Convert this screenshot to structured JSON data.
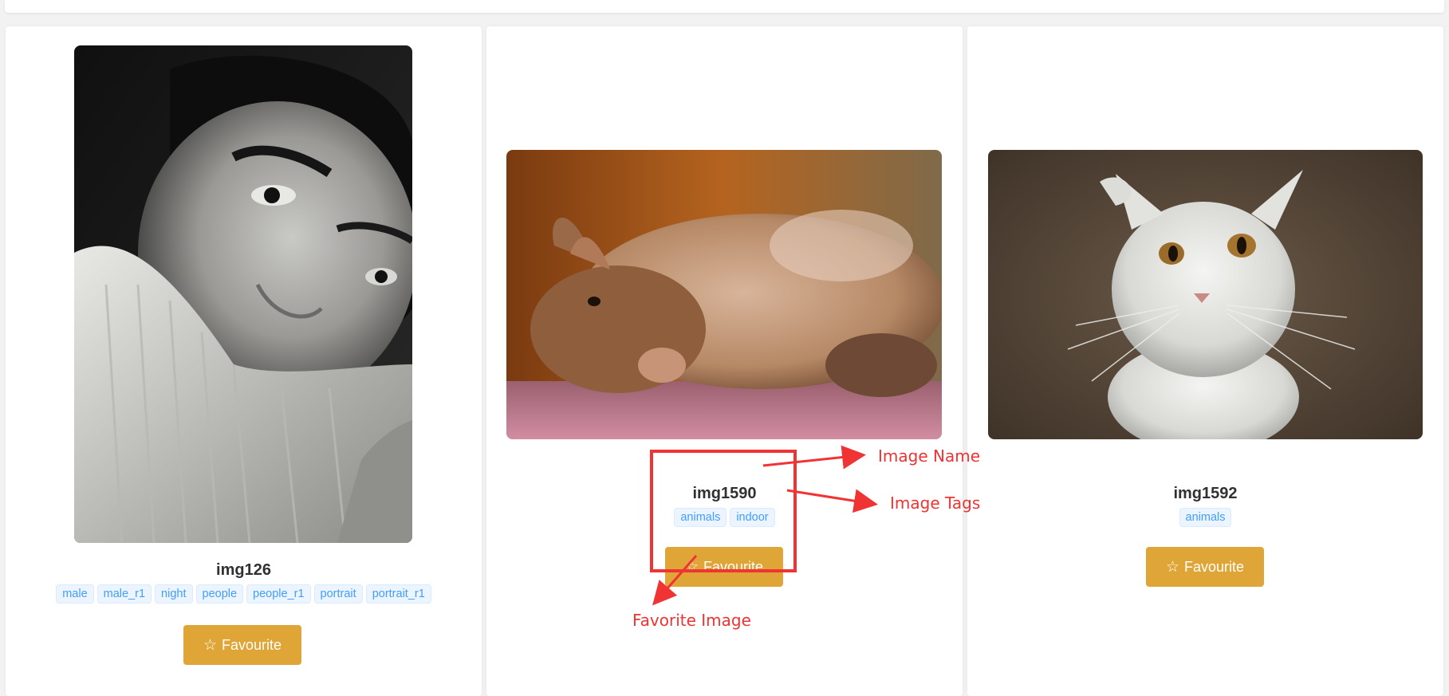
{
  "cards": [
    {
      "name": "img126",
      "tags": [
        "male",
        "male_r1",
        "night",
        "people",
        "people_r1",
        "portrait",
        "portrait_r1"
      ],
      "button_label": "Favourite",
      "image_subject": "portrait of a young man wrapped in a white knit sweater"
    },
    {
      "name": "img1590",
      "tags": [
        "animals",
        "indoor"
      ],
      "button_label": "Favourite",
      "image_subject": "brown rabbit lying on a pink carpet"
    },
    {
      "name": "img1592",
      "tags": [
        "animals"
      ],
      "button_label": "Favourite",
      "image_subject": "white long-haired cat looking up"
    }
  ],
  "annotations": {
    "image_name": "Image Name",
    "image_tags": "Image Tags",
    "favorite_image": "Favorite Image",
    "color": "#f03333"
  },
  "colors": {
    "button": "#e0a537",
    "tag_text": "#409eff",
    "tag_bg": "#ecf5ff",
    "background": "#f2f2f2"
  },
  "icons": {
    "button_icon": "star-outline-icon"
  }
}
